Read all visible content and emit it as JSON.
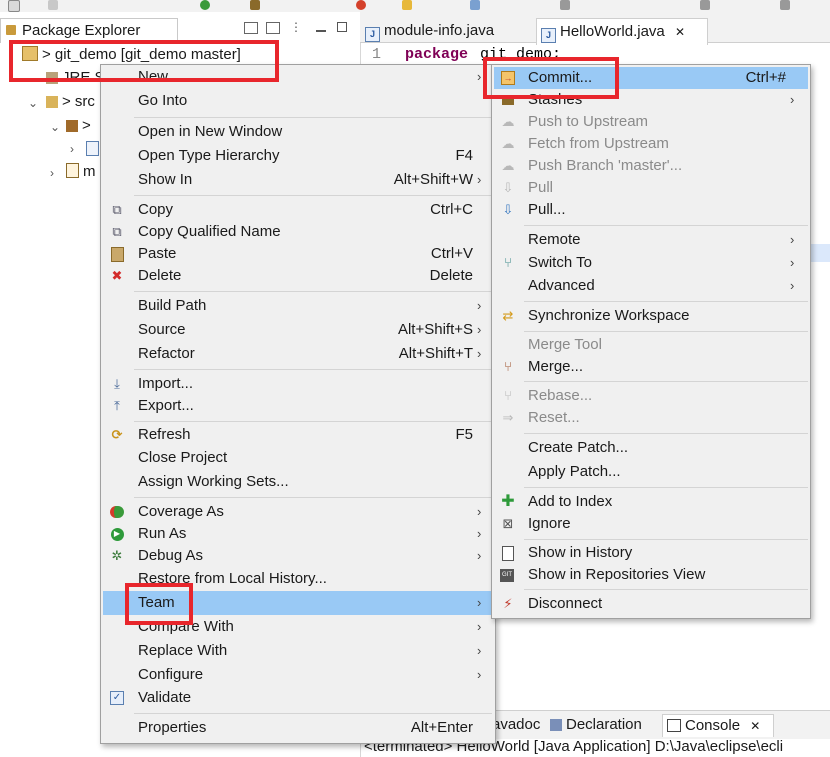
{
  "colors": {
    "highlight": "#99c9f5",
    "annotation": "#e8262c",
    "menu_bg": "#f0f0f0",
    "keyword": "#7f0055"
  },
  "package_explorer": {
    "tab_label": "Package Explorer",
    "rows": [
      {
        "label": "> git_demo [git_demo master]",
        "icon": "project-icon"
      },
      {
        "label": "JRE S",
        "icon": "library-icon"
      },
      {
        "label": "> src",
        "icon": "source-folder-icon"
      },
      {
        "label": ">",
        "icon": "package-icon"
      },
      {
        "label": "",
        "icon": "java-file-icon"
      },
      {
        "label": "m",
        "icon": "module-info-icon"
      }
    ]
  },
  "editor": {
    "tabs": [
      {
        "label": "module-info.java"
      },
      {
        "label": "HelloWorld.java",
        "close": "✕"
      }
    ],
    "line_number": "1",
    "code_keyword": "package",
    "code_rest": "git_demo;"
  },
  "console": {
    "tabs": [
      "avadoc",
      "Declaration",
      "Console"
    ],
    "close": "✕",
    "status": "<terminated> HelloWorld [Java Application] D:\\Java\\eclipse\\ecli"
  },
  "context_menu": {
    "items": [
      {
        "label": "New",
        "arrow": "›"
      },
      {
        "label": "Go Into"
      },
      {
        "label": "Open in New Window"
      },
      {
        "label": "Open Type Hierarchy",
        "shortcut": "F4"
      },
      {
        "label": "Show In",
        "shortcut": "Alt+Shift+W",
        "arrow": "›"
      },
      {
        "label": "Copy",
        "shortcut": "Ctrl+C",
        "icon": "copy-icon"
      },
      {
        "label": "Copy Qualified Name",
        "icon": "copy-qualified-name-icon"
      },
      {
        "label": "Paste",
        "shortcut": "Ctrl+V",
        "icon": "paste-icon"
      },
      {
        "label": "Delete",
        "shortcut": "Delete",
        "icon": "delete-icon"
      },
      {
        "label": "Build Path",
        "arrow": "›"
      },
      {
        "label": "Source",
        "shortcut": "Alt+Shift+S",
        "arrow": "›"
      },
      {
        "label": "Refactor",
        "shortcut": "Alt+Shift+T",
        "arrow": "›"
      },
      {
        "label": "Import...",
        "icon": "import-icon"
      },
      {
        "label": "Export...",
        "icon": "export-icon"
      },
      {
        "label": "Refresh",
        "shortcut": "F5",
        "icon": "refresh-icon"
      },
      {
        "label": "Close Project"
      },
      {
        "label": "Assign Working Sets..."
      },
      {
        "label": "Coverage As",
        "arrow": "›",
        "icon": "coverage-icon"
      },
      {
        "label": "Run As",
        "arrow": "›",
        "icon": "run-icon"
      },
      {
        "label": "Debug As",
        "arrow": "›",
        "icon": "debug-icon"
      },
      {
        "label": "Restore from Local History..."
      },
      {
        "label": "Team",
        "arrow": "›",
        "highlighted": true
      },
      {
        "label": "Compare With",
        "arrow": "›"
      },
      {
        "label": "Replace With",
        "arrow": "›"
      },
      {
        "label": "Configure",
        "arrow": "›"
      },
      {
        "label": "Validate",
        "icon": "checkbox-checked-icon"
      },
      {
        "label": "Properties",
        "shortcut": "Alt+Enter"
      }
    ]
  },
  "team_menu": {
    "items": [
      {
        "label": "Commit...",
        "shortcut": "Ctrl+#",
        "icon": "commit-icon",
        "highlighted": true
      },
      {
        "label": "Stashes",
        "arrow": "›",
        "icon": "stash-icon"
      },
      {
        "label": "Push to Upstream",
        "icon": "push-upstream-icon",
        "disabled": true
      },
      {
        "label": "Fetch from Upstream",
        "icon": "fetch-upstream-icon",
        "disabled": true
      },
      {
        "label": "Push Branch 'master'...",
        "icon": "push-branch-icon",
        "disabled": true
      },
      {
        "label": "Pull",
        "icon": "pull-icon",
        "disabled": true
      },
      {
        "label": "Pull...",
        "icon": "pull-dialog-icon"
      },
      {
        "label": "Remote",
        "arrow": "›"
      },
      {
        "label": "Switch To",
        "arrow": "›",
        "icon": "switch-branch-icon"
      },
      {
        "label": "Advanced",
        "arrow": "›"
      },
      {
        "label": "Synchronize Workspace",
        "icon": "synchronize-icon"
      },
      {
        "label": "Merge Tool",
        "disabled": true
      },
      {
        "label": "Merge...",
        "icon": "merge-icon"
      },
      {
        "label": "Rebase...",
        "icon": "rebase-icon",
        "disabled": true
      },
      {
        "label": "Reset...",
        "icon": "reset-icon",
        "disabled": true
      },
      {
        "label": "Create Patch..."
      },
      {
        "label": "Apply Patch..."
      },
      {
        "label": "Add to Index",
        "icon": "add-to-index-icon"
      },
      {
        "label": "Ignore",
        "icon": "ignore-icon"
      },
      {
        "label": "Show in History",
        "icon": "history-icon"
      },
      {
        "label": "Show in Repositories View",
        "icon": "repositories-view-icon"
      },
      {
        "label": "Disconnect",
        "icon": "disconnect-icon"
      }
    ]
  }
}
